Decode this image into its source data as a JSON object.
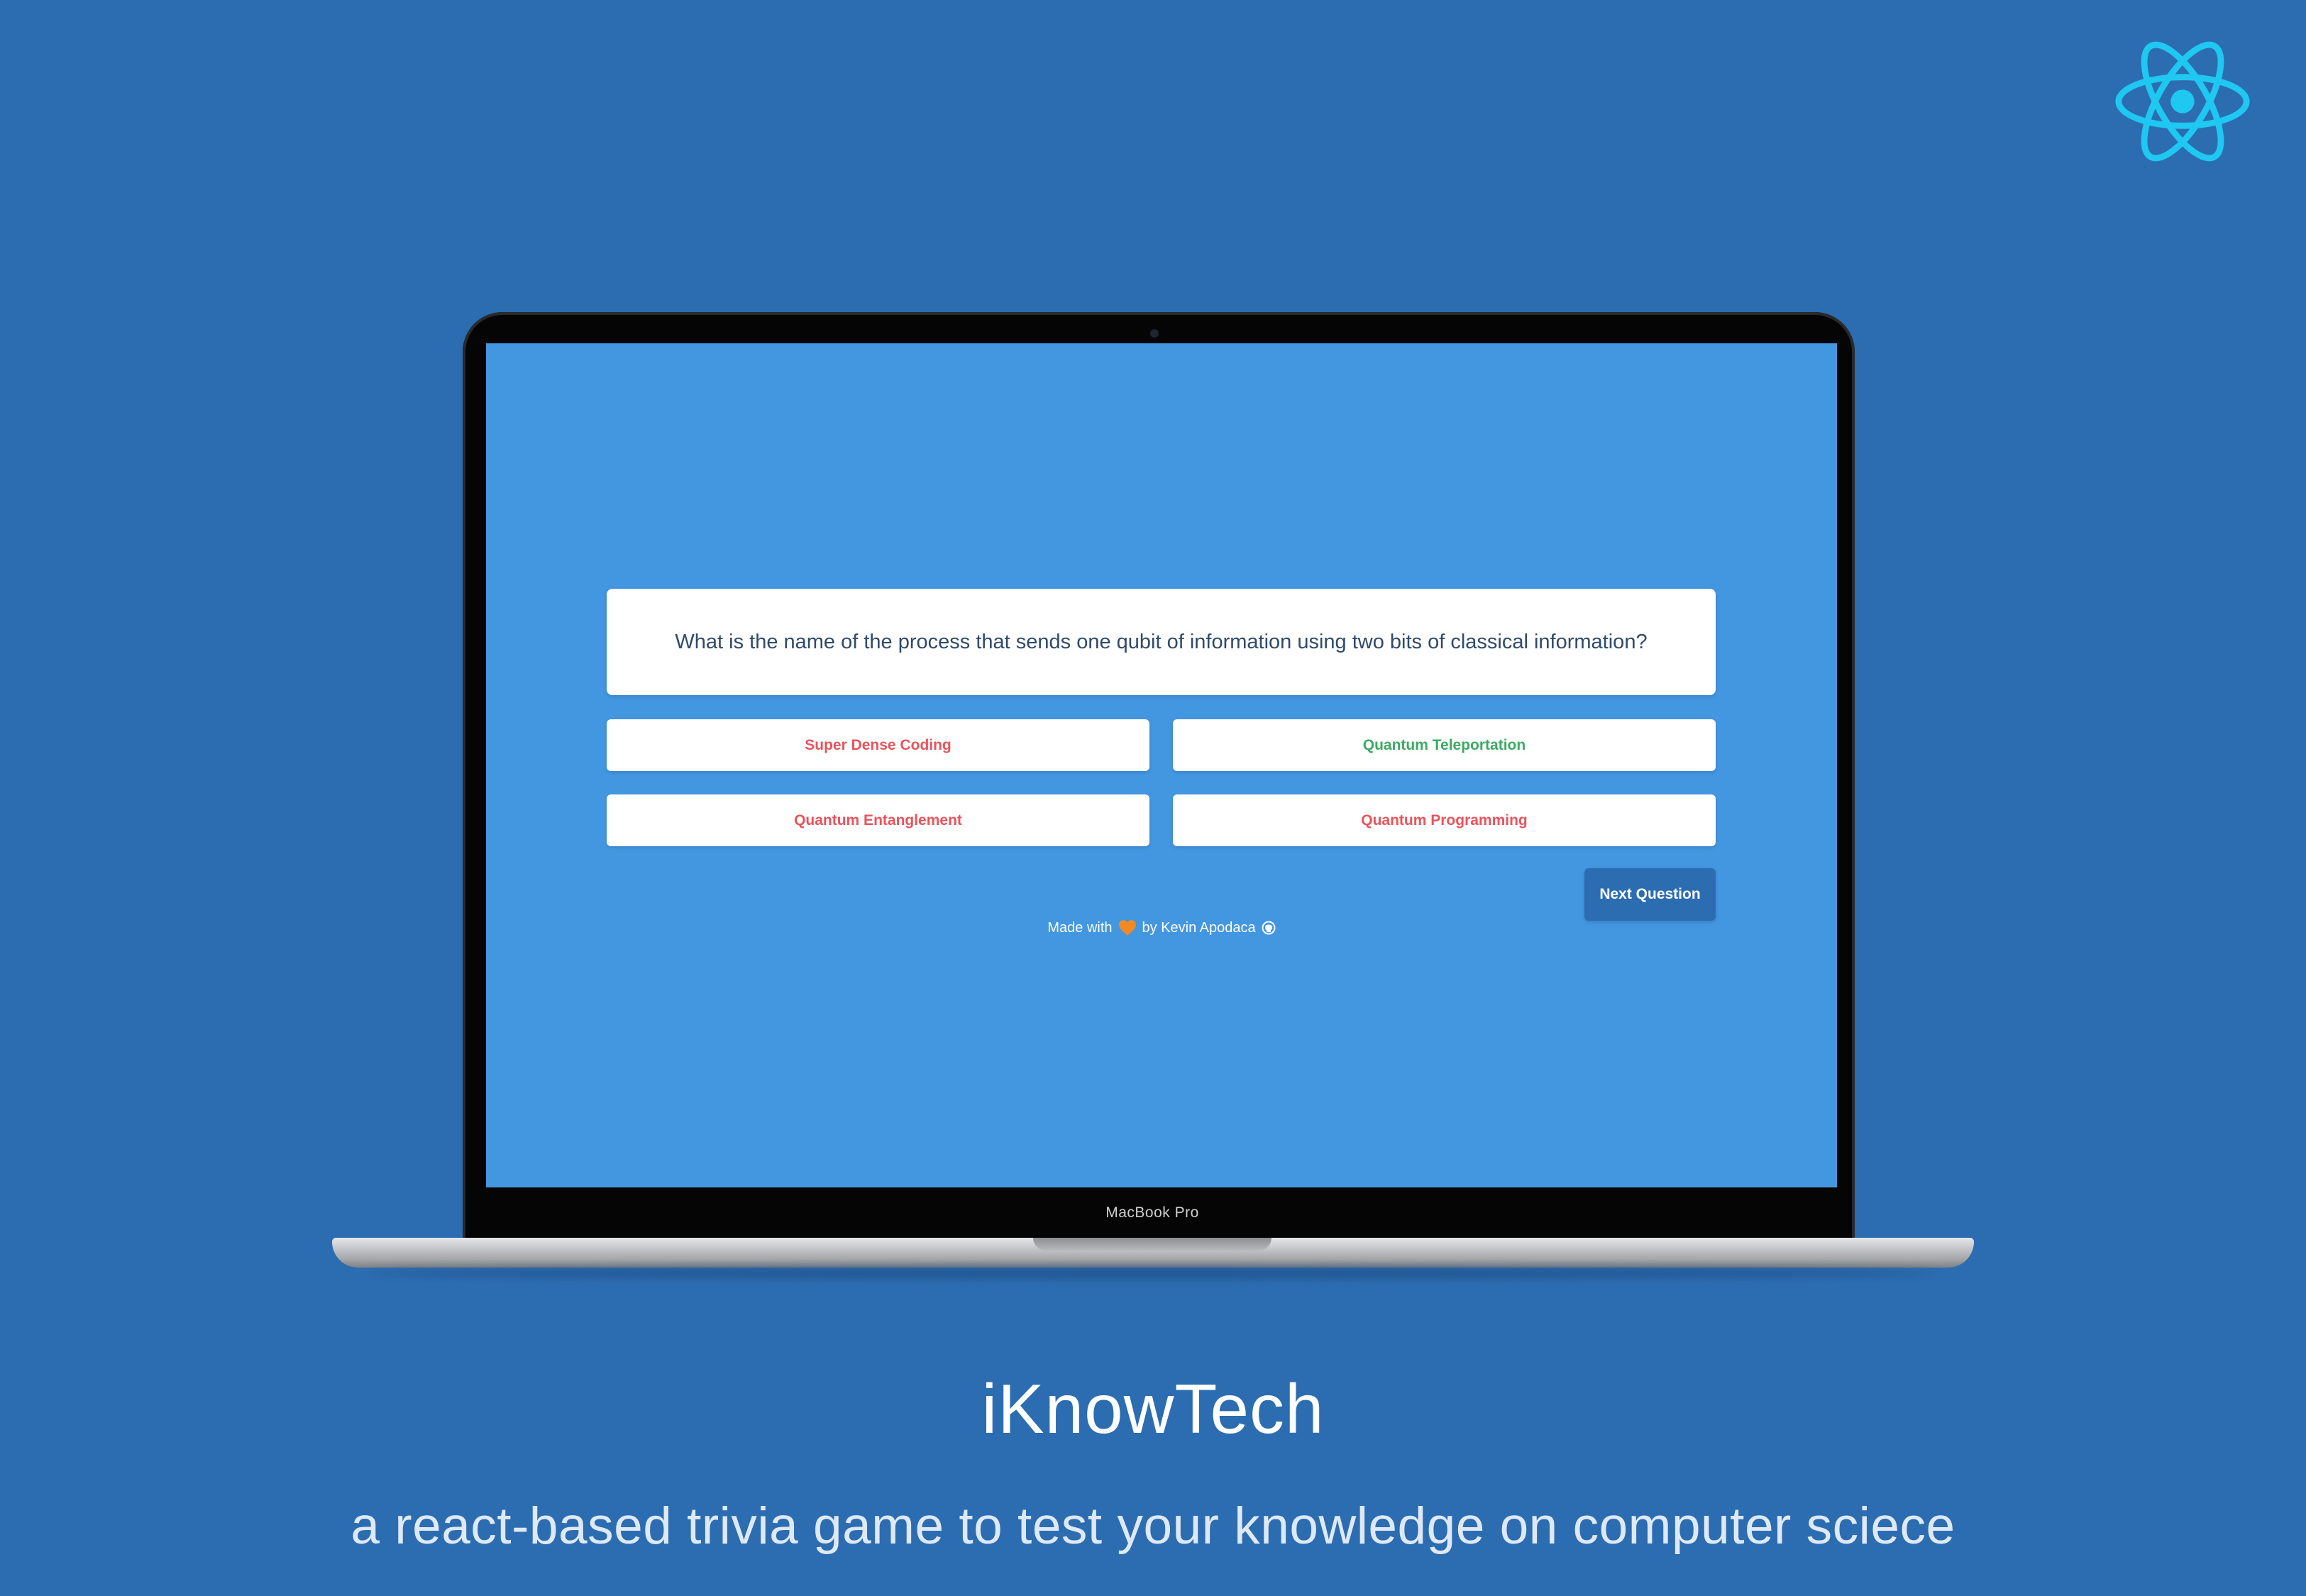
{
  "app": {
    "question": "What is the name of the process that sends one qubit of information using two bits of classical information?",
    "answers": [
      {
        "label": "Super Dense Coding",
        "state": "incorrect"
      },
      {
        "label": "Quantum Teleportation",
        "state": "correct"
      },
      {
        "label": "Quantum Entanglement",
        "state": "incorrect"
      },
      {
        "label": "Quantum Programming",
        "state": "incorrect"
      }
    ],
    "next_button_label": "Next Question",
    "footer": {
      "made_with": "Made with",
      "by": "by Kevin Apodaca",
      "heart_icon": "orange-heart-icon",
      "link_icon": "github-icon"
    }
  },
  "device": {
    "label": "MacBook Pro"
  },
  "promo": {
    "title": "iKnowTech",
    "subtitle": "a react-based trivia game to test your knowledge on computer sciece"
  },
  "logo": {
    "icon": "react-logo-icon"
  },
  "colors": {
    "page_background": "#2c6db2",
    "screen_background": "#4396e0",
    "correct": "#3daa62",
    "incorrect": "#e9535c",
    "react_logo": "#1ec8f0",
    "next_button": "#2c6db2"
  }
}
